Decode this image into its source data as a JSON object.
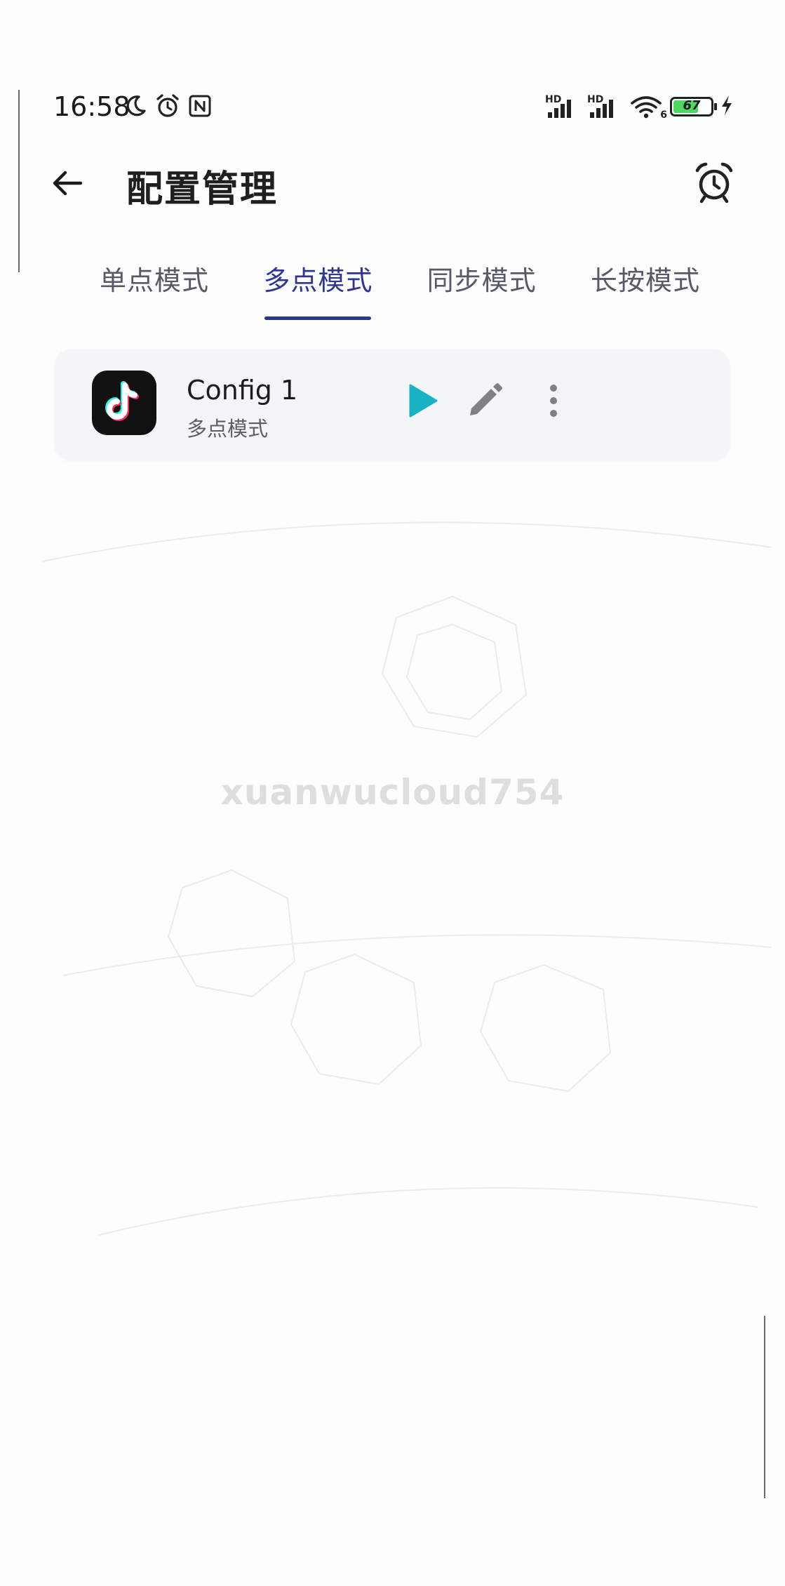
{
  "status_bar": {
    "time": "16:58",
    "left_icons": [
      "moon-icon",
      "alarm-clock-icon",
      "nfc-icon"
    ],
    "signal_1_label": "HD",
    "signal_2_label": "HD",
    "wifi_badge": "6",
    "battery_percent": "67",
    "battery_level": 0.67,
    "charging": true
  },
  "header": {
    "back_icon": "arrow-left-icon",
    "title": "配置管理",
    "action_icon": "alarm-clock-icon"
  },
  "tabs": [
    {
      "label": "单点模式",
      "active": false
    },
    {
      "label": "多点模式",
      "active": true
    },
    {
      "label": "同步模式",
      "active": false
    },
    {
      "label": "长按模式",
      "active": false
    }
  ],
  "configs": [
    {
      "name": "Config 1",
      "mode": "多点模式",
      "app_icon": "tiktok-icon",
      "actions": [
        "play-icon",
        "pencil-icon",
        "more-vertical-icon"
      ]
    }
  ],
  "watermark": "xuanwucloud754",
  "colors": {
    "accent": "#2e3692",
    "play": "#1ab3c6",
    "edit": "#7d8187",
    "card_bg": "#f3f5f8",
    "battery_fill": "#4cd964"
  }
}
